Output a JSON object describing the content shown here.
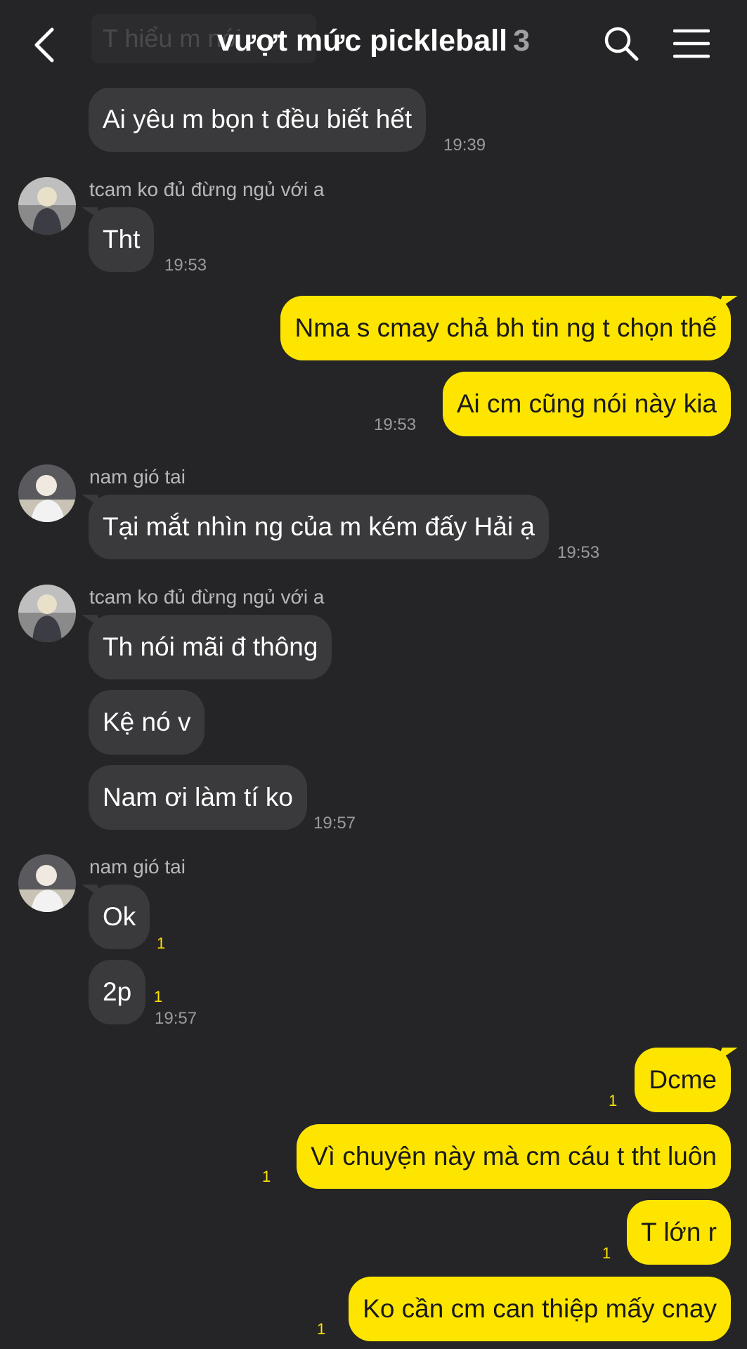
{
  "header": {
    "ghost_text": "T hiểu m nói",
    "title": "vượt mức pickleball",
    "member_count": "3"
  },
  "messages": {
    "m1": {
      "text": "Ai yêu m bọn t đều biết hết",
      "time": "19:39"
    },
    "tcam1": {
      "sender": "tcam ko đủ đừng ngủ với a",
      "text": "Tht",
      "time": "19:53"
    },
    "me1": {
      "text": "Nma s cmay chả bh tin ng t chọn thế"
    },
    "me2": {
      "text": "Ai cm cũng nói này kia",
      "time": "19:53"
    },
    "nam1": {
      "sender": "nam gió tai",
      "text": "Tại mắt nhìn ng của m kém đấy Hải ạ",
      "time": "19:53"
    },
    "tcam2": {
      "sender": "tcam ko đủ đừng ngủ với a",
      "texts": [
        "Th nói mãi đ thông",
        "Kệ nó v",
        "Nam ơi làm tí ko"
      ],
      "time": "19:57"
    },
    "nam2": {
      "sender": "nam gió tai",
      "texts": [
        "Ok",
        "2p"
      ],
      "unread": [
        "1",
        "1"
      ],
      "time": "19:57"
    },
    "me3": {
      "texts": [
        "Dcme",
        "Vì chuyện này mà cm cáu t tht luôn",
        "T lớn r",
        "Ko cần cm can thiệp mấy cnay"
      ],
      "unread": [
        "1",
        "1",
        "1",
        "1"
      ]
    }
  },
  "colors": {
    "background": "#252527",
    "incoming": "#3a3a3c",
    "outgoing": "#fee500"
  }
}
